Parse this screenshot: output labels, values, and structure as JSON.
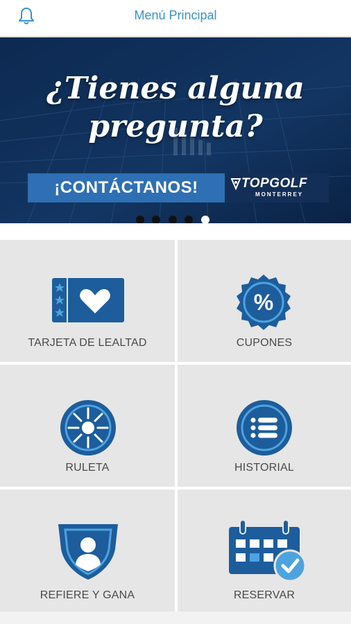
{
  "header": {
    "title": "Menú Principal",
    "notification_icon": "bell-icon"
  },
  "banner": {
    "headline_line1": "¿Tienes alguna",
    "headline_line2": "pregunta?",
    "cta_label": "¡CONTÁCTANOS!",
    "brand_name": "TOPGOLF",
    "brand_location": "MONTERREY",
    "slide_count": 5,
    "active_slide": 5
  },
  "menu": {
    "items": [
      {
        "label": "TARJETA DE LEALTAD",
        "icon": "loyalty-card-icon"
      },
      {
        "label": "CUPONES",
        "icon": "percent-badge-icon"
      },
      {
        "label": "RULETA",
        "icon": "roulette-icon"
      },
      {
        "label": "HISTORIAL",
        "icon": "list-icon"
      },
      {
        "label": "REFIERE Y GANA",
        "icon": "referral-shield-icon"
      },
      {
        "label": "RESERVAR",
        "icon": "calendar-check-icon"
      }
    ]
  },
  "colors": {
    "accent": "#3a93c8",
    "icon_blue": "#1d5d9c",
    "tile_bg": "#e6e6e6",
    "banner_bg": "#0c2a52"
  }
}
